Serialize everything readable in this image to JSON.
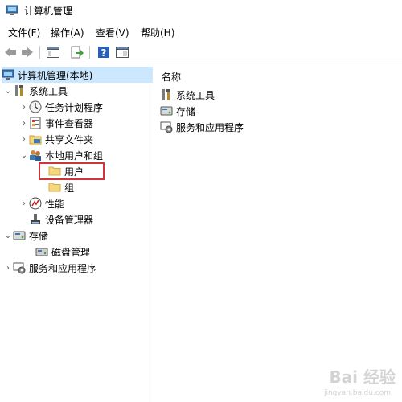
{
  "window": {
    "title": "计算机管理"
  },
  "menu": [
    {
      "label": "文件(F)"
    },
    {
      "label": "操作(A)"
    },
    {
      "label": "查看(V)"
    },
    {
      "label": "帮助(H)"
    }
  ],
  "toolbar": {
    "icons": [
      "back-arrow-icon",
      "forward-arrow-icon",
      "show-hide-tree-icon",
      "export-list-icon",
      "help-icon",
      "properties-icon"
    ]
  },
  "tree": {
    "root": {
      "label": "计算机管理(本地)"
    },
    "items": [
      {
        "label": "系统工具",
        "expanded": true
      },
      {
        "label": "任务计划程序"
      },
      {
        "label": "事件查看器"
      },
      {
        "label": "共享文件夹"
      },
      {
        "label": "本地用户和组",
        "expanded": true
      },
      {
        "label": "用户"
      },
      {
        "label": "组"
      },
      {
        "label": "性能"
      },
      {
        "label": "设备管理器"
      },
      {
        "label": "存储",
        "expanded": true
      },
      {
        "label": "磁盘管理"
      },
      {
        "label": "服务和应用程序"
      }
    ]
  },
  "list": {
    "column": "名称",
    "items": [
      {
        "label": "系统工具"
      },
      {
        "label": "存储"
      },
      {
        "label": "服务和应用程序"
      }
    ]
  },
  "watermark": {
    "main": "Bai 经验",
    "sub": "jingyan.baidu.com"
  },
  "colors": {
    "selection": "#cce8ff",
    "highlight_box": "#d0343a",
    "folder": "#f5d77e"
  }
}
